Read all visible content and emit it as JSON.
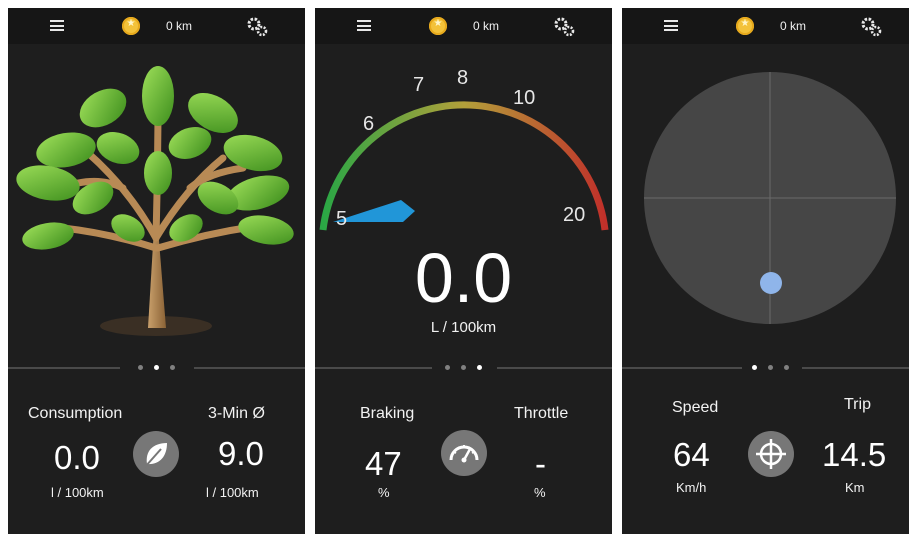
{
  "topbar": {
    "distance": "0 km",
    "icons": [
      "menu-icon",
      "coin-icon",
      "gear-icon"
    ]
  },
  "screen1": {
    "illustration": "tree",
    "left": {
      "label": "Consumption",
      "value": "0.0",
      "unit": "l / 100km"
    },
    "right": {
      "label": "3-Min Ø",
      "value": "9.0",
      "unit": "l / 100km"
    },
    "center_icon": "leaf-icon",
    "page_indicator_active": 1
  },
  "screen2": {
    "gauge": {
      "ticks": [
        "5",
        "6",
        "7",
        "8",
        "10",
        "20"
      ],
      "value": "0.0",
      "unit": "L / 100km",
      "colors": [
        "#2aa745",
        "#b3a03a",
        "#c0302a"
      ],
      "needle_color": "#2196d8"
    },
    "left": {
      "label": "Braking",
      "value": "47",
      "unit": "%"
    },
    "right": {
      "label": "Throttle",
      "value": "-",
      "unit": "%"
    },
    "center_icon": "speedometer-icon",
    "page_indicator_active": 2
  },
  "screen3": {
    "left": {
      "label": "Speed",
      "value": "64",
      "unit": "Km/h"
    },
    "right": {
      "label": "Trip",
      "value": "14.5",
      "unit": "Km"
    },
    "center_icon": "crosshair-icon",
    "page_indicator_active": 0,
    "marker_color": "#8fb5ea"
  }
}
